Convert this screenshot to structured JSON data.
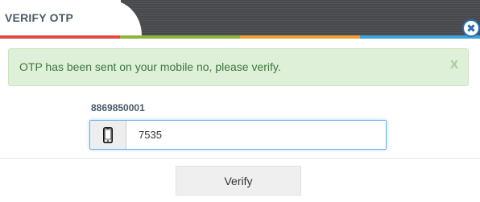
{
  "dialog": {
    "title": "VERIFY OTP",
    "close_symbol": "✖",
    "colors": {
      "strip": [
        "#e04a3f",
        "#8fb43a",
        "#f0a330",
        "#3aa5d8"
      ],
      "alert_bg": "#dff0d8",
      "alert_text": "#3c763d",
      "header_dark": "#48494d"
    }
  },
  "alert": {
    "message": "OTP has been sent on your mobile no, please verify.",
    "dismiss_label": "X"
  },
  "form": {
    "mobile_number": "8869850001",
    "addon_icon": "mobile-phone-icon",
    "otp_value": "7535"
  },
  "actions": {
    "verify_label": "Verify"
  }
}
